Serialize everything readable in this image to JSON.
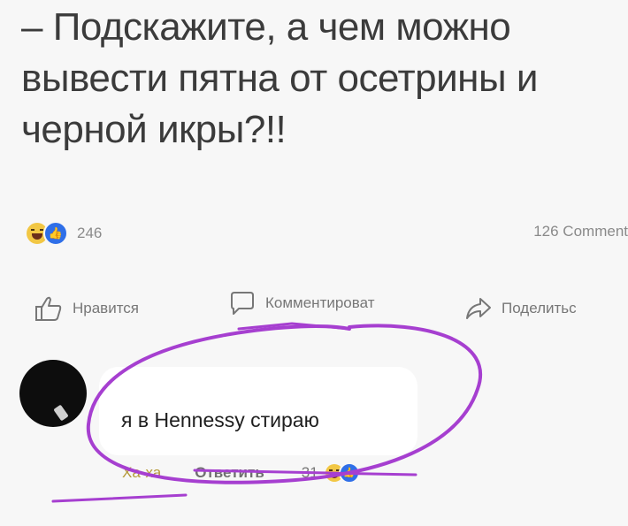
{
  "post": {
    "text_line1": "– Подскажите, а чем можно",
    "text_line2": "вывести пятна от осетрины и",
    "text_line3": "черной икры?!!"
  },
  "reactions": {
    "icons": [
      "haha-emoji-icon",
      "like-icon"
    ],
    "count": "246"
  },
  "comments_count": "126 Comment",
  "actions": {
    "like": "Нравится",
    "comment": "Комментироват",
    "share": "Поделитьс"
  },
  "comment": {
    "text": "я в Hennessy стираю",
    "haha_label": "Ха-ха",
    "reply_label": "Ответить",
    "reaction_count": "31",
    "reaction_icons": [
      "haha-emoji-icon",
      "like-icon"
    ]
  },
  "colors": {
    "background": "#f7f7f7",
    "annotation_scribble": "#a63fd0",
    "like_blue": "#2f6fe8",
    "emoji_yellow": "#f2c744"
  }
}
